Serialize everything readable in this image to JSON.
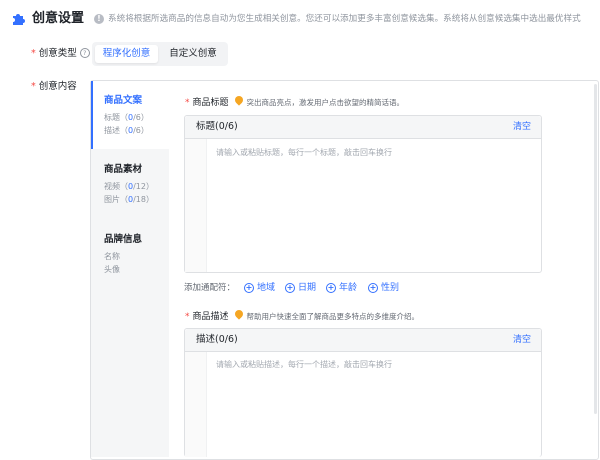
{
  "header": {
    "title": "创意设置",
    "description": "系统将根据所选商品的信息自动为您生成相关创意。您还可以添加更多丰富创意候选集。系统将从创意候选集中选出最优样式"
  },
  "creative_type": {
    "label": "创意类型",
    "options": [
      "程序化创意",
      "自定义创意"
    ],
    "selected": "程序化创意"
  },
  "creative_content": {
    "label": "创意内容",
    "nav": [
      {
        "title": "商品文案",
        "items": [
          {
            "label": "标题",
            "count": "0",
            "max": "6"
          },
          {
            "label": "描述",
            "count": "0",
            "max": "6"
          }
        ]
      },
      {
        "title": "商品素材",
        "items": [
          {
            "label": "视频",
            "count": "0",
            "max": "12"
          },
          {
            "label": "图片",
            "count": "0",
            "max": "18"
          }
        ]
      },
      {
        "title": "品牌信息",
        "items": [
          {
            "label": "名称"
          },
          {
            "label": "头像"
          }
        ]
      }
    ]
  },
  "product_title": {
    "label": "商品标题",
    "hint": "突出商品亮点，激发用户点击欲望的精简话语。",
    "box_title": "标题(0/6)",
    "clear": "清空",
    "placeholder": "请输入或粘贴标题，每行一个标题，敲击回车换行",
    "slots_label": "添加通配符：",
    "slots": [
      "地域",
      "日期",
      "年龄",
      "性别"
    ]
  },
  "product_desc": {
    "label": "商品描述",
    "hint": "帮助用户快速全面了解商品更多特点的多维度介绍。",
    "box_title": "描述(0/6)",
    "clear": "清空",
    "placeholder": "请输入或粘贴描述，每行一个描述，敲击回车换行"
  },
  "colors": {
    "accent": "#3370ff",
    "required": "#f54a45",
    "tip": "#f5a623"
  }
}
